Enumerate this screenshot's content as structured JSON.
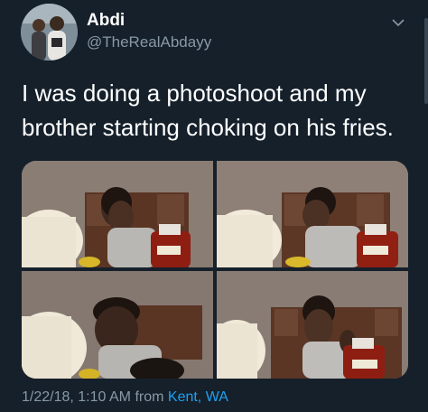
{
  "user": {
    "display_name": "Abdi",
    "handle": "@TheRealAbdayy"
  },
  "tweet": {
    "text": "I was doing a photoshoot and my brother starting choking on his fries.",
    "timestamp": "1/22/18, 1:10 AM",
    "from_label": "from",
    "location": "Kent, WA"
  },
  "icons": {
    "menu": "chevron-down-icon"
  },
  "colors": {
    "background": "#15202b",
    "secondary_text": "#8899a6",
    "link": "#1da1f2"
  }
}
